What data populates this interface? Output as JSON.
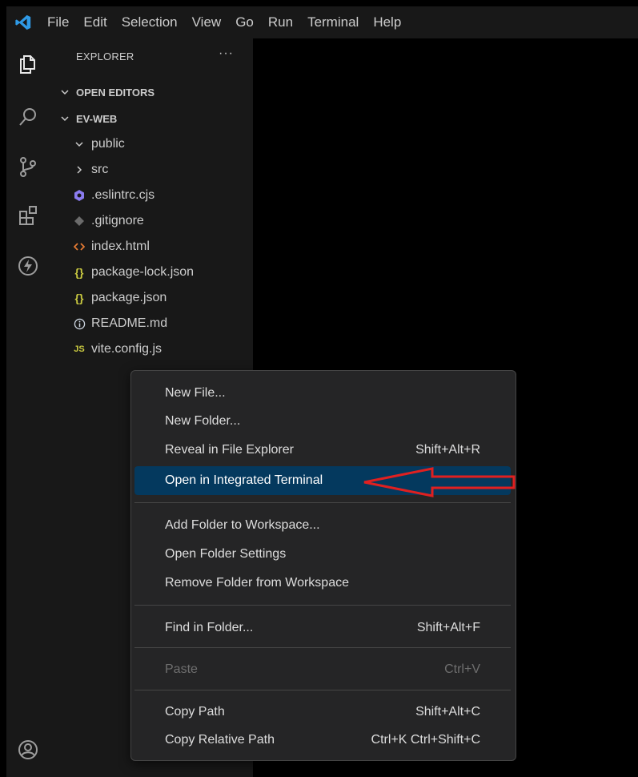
{
  "menubar": {
    "items": [
      "File",
      "Edit",
      "Selection",
      "View",
      "Go",
      "Run",
      "Terminal",
      "Help"
    ]
  },
  "activitybar": {
    "icons": [
      "explorer-icon",
      "search-icon",
      "source-control-icon",
      "extensions-icon",
      "lightning-icon",
      "account-icon"
    ]
  },
  "sidebar": {
    "title": "EXPLORER",
    "more": "···",
    "open_editors": "OPEN EDITORS",
    "root": "EV-WEB",
    "tree": [
      {
        "label": "public",
        "kind": "folder-open"
      },
      {
        "label": "src",
        "kind": "folder-closed"
      },
      {
        "label": ".eslintrc.cjs",
        "kind": "eslint"
      },
      {
        "label": ".gitignore",
        "kind": "git"
      },
      {
        "label": "index.html",
        "kind": "html"
      },
      {
        "label": "package-lock.json",
        "kind": "json"
      },
      {
        "label": "package.json",
        "kind": "json"
      },
      {
        "label": "README.md",
        "kind": "info"
      },
      {
        "label": "vite.config.js",
        "kind": "js"
      }
    ]
  },
  "context_menu": {
    "items": [
      {
        "label": "New File...",
        "shortcut": ""
      },
      {
        "label": "New Folder...",
        "shortcut": ""
      },
      {
        "label": "Reveal in File Explorer",
        "shortcut": "Shift+Alt+R"
      },
      {
        "label": "Open in Integrated Terminal",
        "shortcut": ""
      },
      {
        "label": "Add Folder to Workspace...",
        "shortcut": ""
      },
      {
        "label": "Open Folder Settings",
        "shortcut": ""
      },
      {
        "label": "Remove Folder from Workspace",
        "shortcut": ""
      },
      {
        "label": "Find in Folder...",
        "shortcut": "Shift+Alt+F"
      },
      {
        "label": "Paste",
        "shortcut": "Ctrl+V"
      },
      {
        "label": "Copy Path",
        "shortcut": "Shift+Alt+C"
      },
      {
        "label": "Copy Relative Path",
        "shortcut": "Ctrl+K Ctrl+Shift+C"
      }
    ],
    "highlighted": "Open in Integrated Terminal",
    "disabled": "Paste"
  },
  "colors": {
    "accent": "#04395e",
    "vscode_blue": "#2f9ae6",
    "annotation_red": "#e02020",
    "json_yellow": "#cbcb41",
    "html_orange": "#e37933",
    "js_yellow": "#cbcb41",
    "eslint_purple": "#8b7cf0",
    "info_blue": "#519aba"
  }
}
